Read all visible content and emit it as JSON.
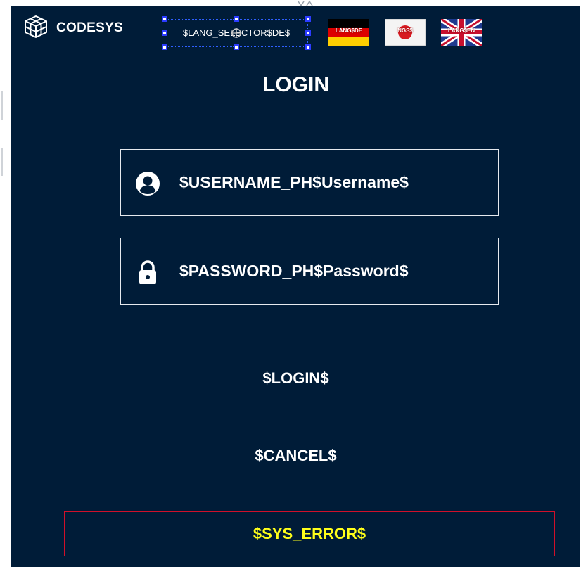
{
  "app": {
    "logo_text": "CODESYS",
    "logo_icon": "codesys-cube-logo"
  },
  "language_selector": {
    "text": "$LANG_SELECTOR$DE$"
  },
  "flags": [
    {
      "label": "LANG$DE",
      "icon": "germany-flag"
    },
    {
      "label": "NGS$",
      "icon": "japan-flag"
    },
    {
      "label": "LANG$EN",
      "icon": "uk-flag"
    }
  ],
  "login": {
    "title": "LOGIN",
    "username_field": {
      "text": "$USERNAME_PH$Username$",
      "icon": "user-icon"
    },
    "password_field": {
      "text": "$PASSWORD_PH$Password$",
      "icon": "lock-icon"
    },
    "login_button": "$LOGIN$",
    "cancel_button": "$CANCEL$",
    "error_text": "$SYS_ERROR$"
  },
  "colors": {
    "background": "#001c38",
    "text": "#ffffff",
    "error_text": "#ffff1a",
    "error_border": "#d0102a",
    "selection": "#2c3cff"
  }
}
